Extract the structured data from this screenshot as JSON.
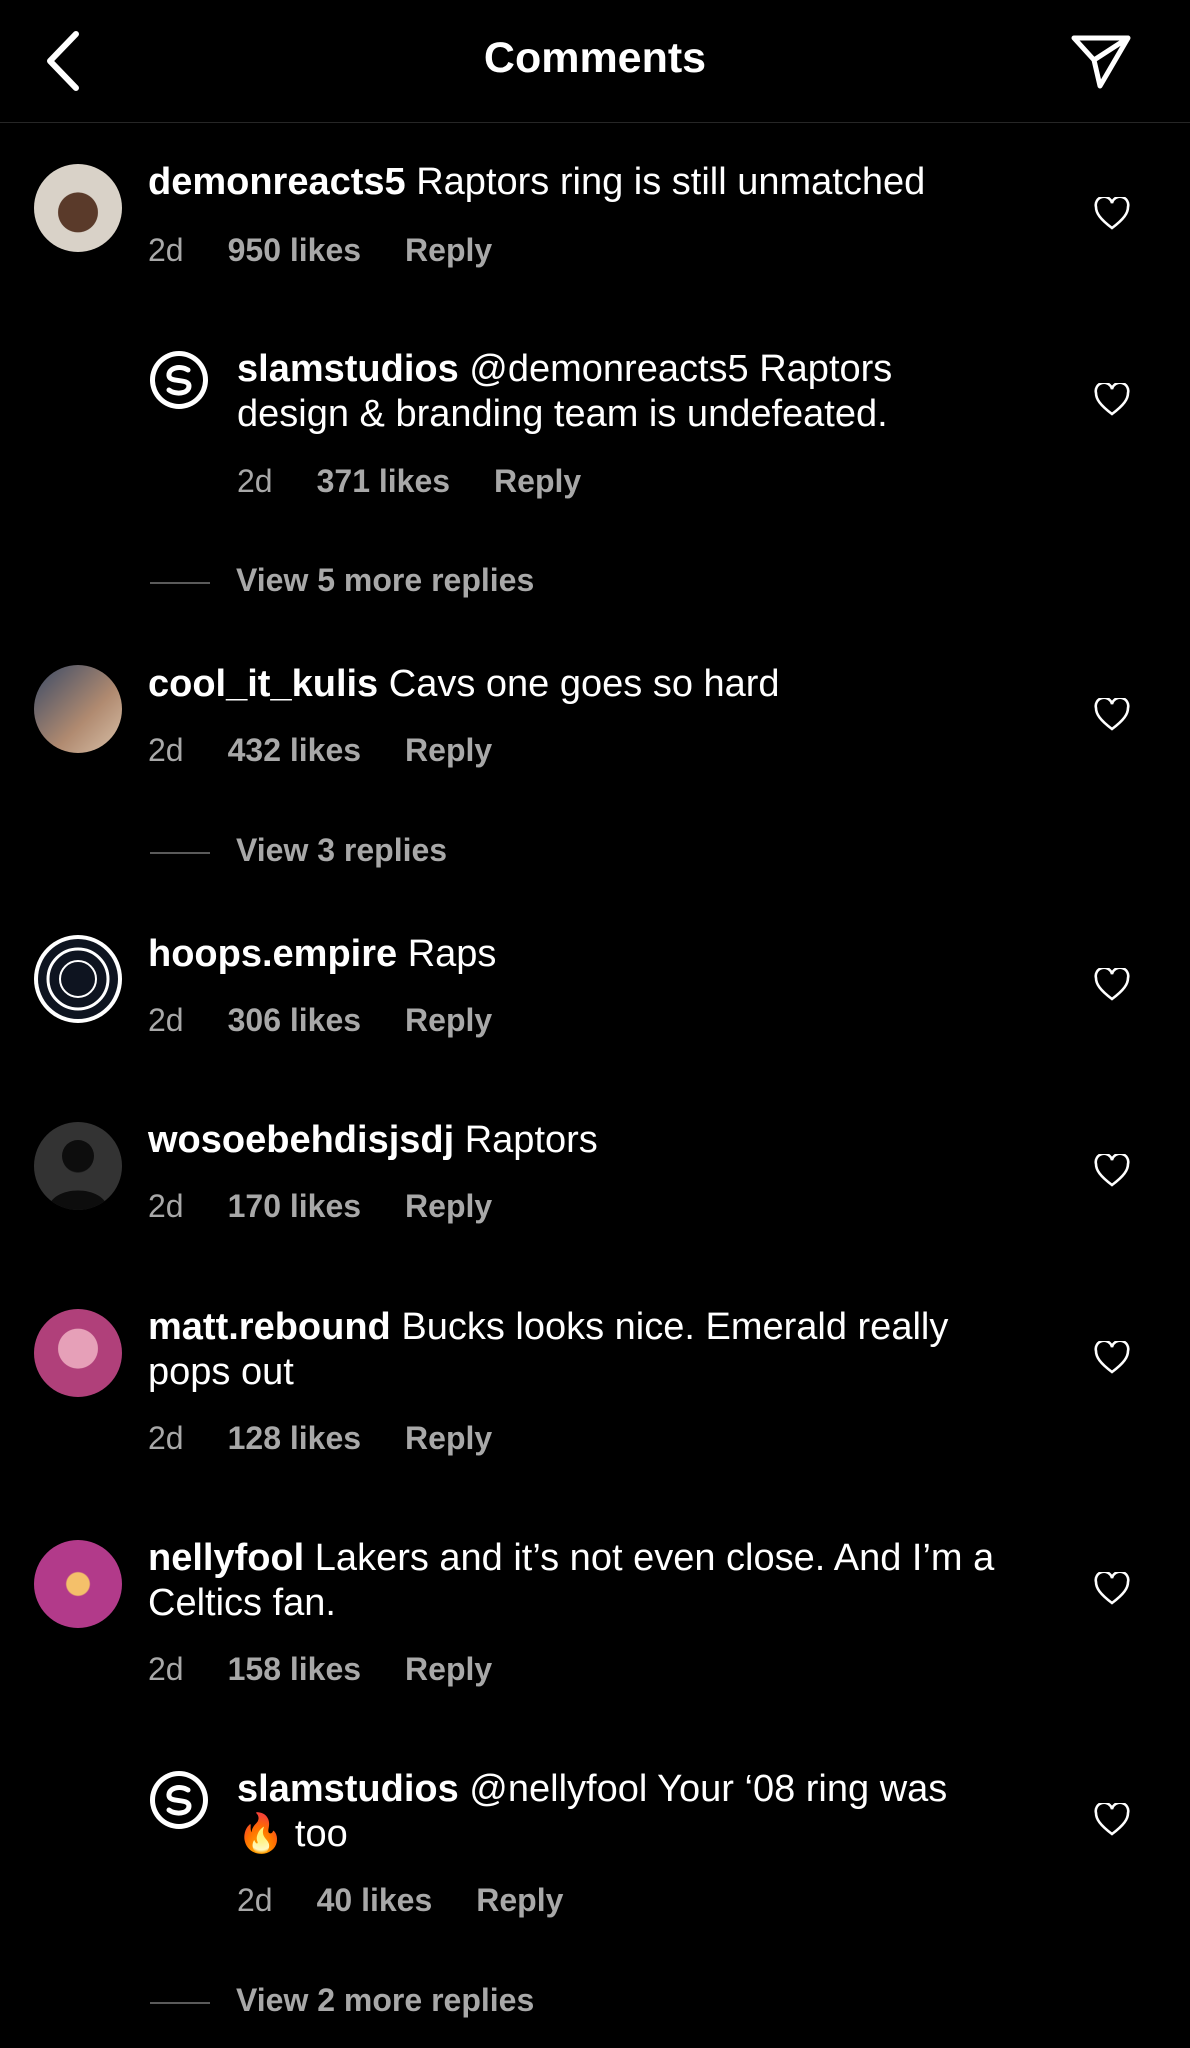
{
  "header": {
    "title": "Comments"
  },
  "comments": [
    {
      "user": "demonreacts5",
      "text": "Raptors ring is still unmatched",
      "time": "2d",
      "likes": "950 likes",
      "reply": "Reply"
    },
    {
      "user": "slamstudios",
      "text": "@demonreacts5 Raptors design & branding team is undefeated.",
      "time": "2d",
      "likes": "371 likes",
      "reply": "Reply"
    },
    {
      "user": "cool_it_kulis",
      "text": "Cavs one goes so hard",
      "time": "2d",
      "likes": "432 likes",
      "reply": "Reply"
    },
    {
      "user": "hoops.empire",
      "text": "Raps",
      "time": "2d",
      "likes": "306 likes",
      "reply": "Reply"
    },
    {
      "user": "wosoebehdisjsdj",
      "text": "Raptors",
      "time": "2d",
      "likes": "170 likes",
      "reply": "Reply"
    },
    {
      "user": "matt.rebound",
      "text": "Bucks looks nice. Emerald really pops out",
      "time": "2d",
      "likes": "128 likes",
      "reply": "Reply"
    },
    {
      "user": "nellyfool",
      "text": "Lakers and it’s not even close. And I’m a Celtics fan.",
      "time": "2d",
      "likes": "158 likes",
      "reply": "Reply"
    },
    {
      "user": "slamstudios",
      "text": "@nellyfool Your ‘08 ring was",
      "emoji": "🔥",
      "text_after": "too",
      "time": "2d",
      "likes": "40 likes",
      "reply": "Reply"
    }
  ],
  "view_more": [
    "View 5 more replies",
    "View 3 replies",
    "View 2 more replies"
  ],
  "colors": {
    "background": "#000000",
    "text": "#ffffff",
    "muted": "#a8a8a8"
  },
  "icons": {
    "back": "chevron-left-icon",
    "send": "paper-plane-icon",
    "like": "heart-outline-icon"
  }
}
